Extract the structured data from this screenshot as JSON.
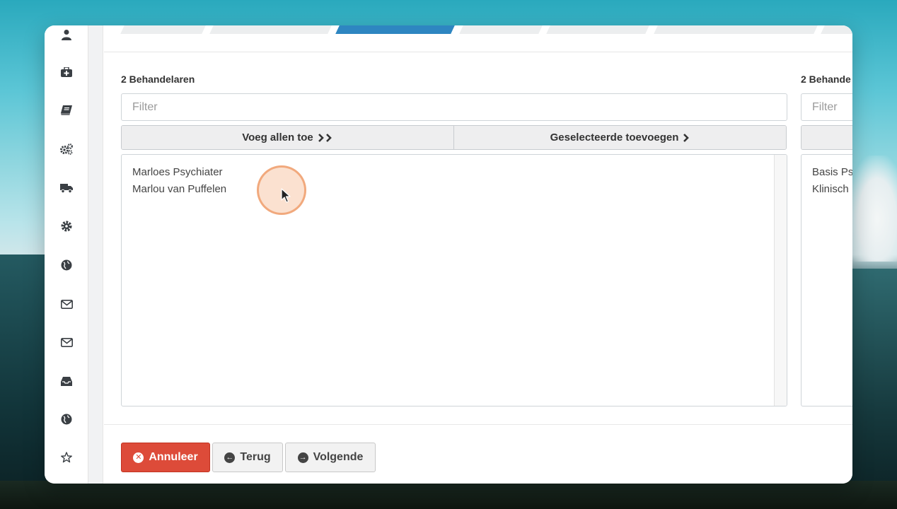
{
  "stepper": {
    "active_step": 3,
    "active_color": "#2e86c1",
    "step_count": 7
  },
  "left_panel": {
    "label": "2 Behandelaren",
    "filter_placeholder": "Filter",
    "move_all_label": "Voeg allen toe",
    "move_selected_label": "Geselecteerde toevoegen",
    "options": [
      "Marloes Psychiater",
      "Marlou van Puffelen"
    ]
  },
  "right_panel": {
    "label": "2 Behande",
    "filter_placeholder": "Filter",
    "options": [
      "Basis Ps",
      "Klinisch"
    ]
  },
  "footer": {
    "cancel_label": "Annuleer",
    "back_label": "Terug",
    "next_label": "Volgende",
    "cancel_color": "#dd4b39"
  },
  "sidebar_icons": [
    "user-icon",
    "medkit-icon",
    "book-icon",
    "cogs-icon",
    "truck-icon",
    "gear-icon",
    "globe-icon",
    "envelope-icon",
    "envelope-icon",
    "inbox-icon",
    "globe-icon",
    "star-icon"
  ]
}
